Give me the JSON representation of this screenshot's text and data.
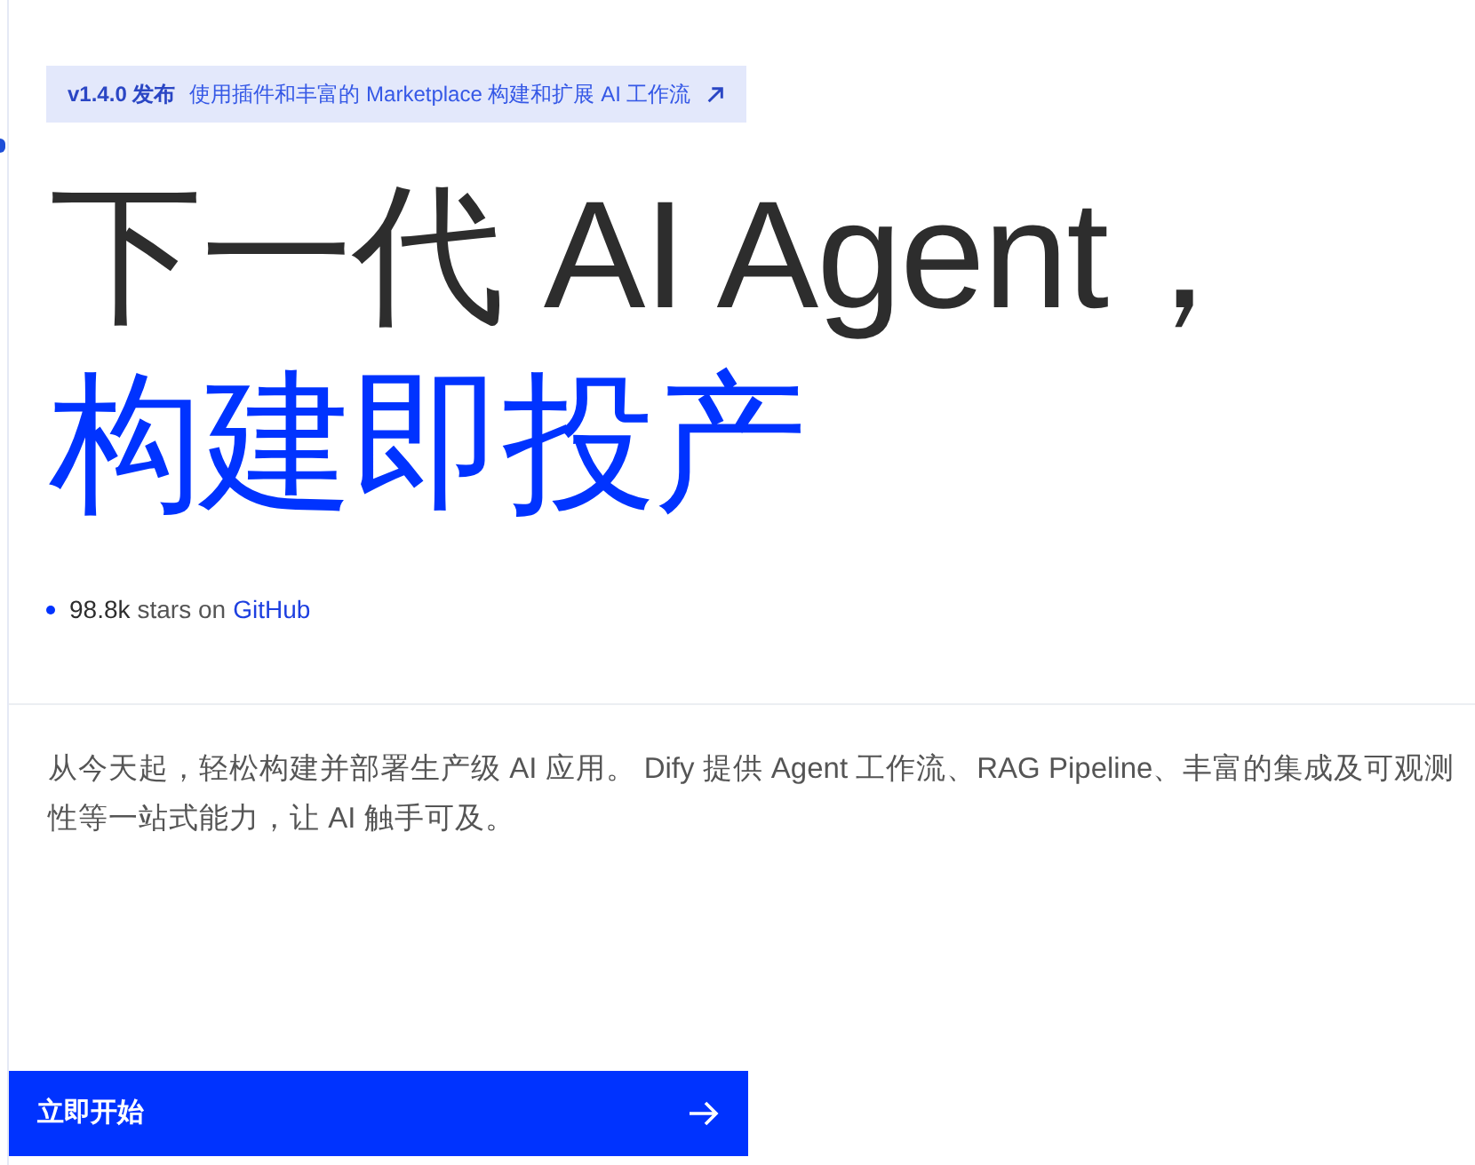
{
  "announcement": {
    "version": "v1.4.0 发布",
    "text": "使用插件和丰富的 Marketplace 构建和扩展 AI 工作流"
  },
  "headline": {
    "line_1": "下一代 AI Agent，",
    "line_2": "构建即投产"
  },
  "stars": {
    "count": "98.8k",
    "text": "stars on",
    "link": "GitHub"
  },
  "description": "从今天起，轻松构建并部署生产级 AI 应用。 Dify 提供 Agent 工作流、RAG Pipeline、丰富的集成及可观测性等一站式能力，让 AI 触手可及。",
  "cta_button": {
    "label": "立即开始"
  }
}
